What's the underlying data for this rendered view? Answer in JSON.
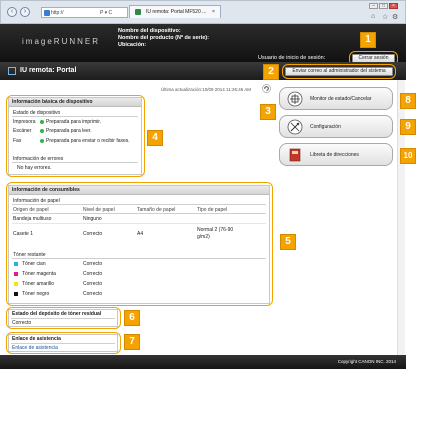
{
  "browser": {
    "url": "http://",
    "url_suffix": "P ▾ C",
    "tab_title": "IU remota: Portal MF520 ...",
    "tab_close": "×",
    "win_controls": [
      "–",
      "□",
      "×"
    ]
  },
  "header": {
    "brand": "imageRUNNER",
    "device_name_label": "Nombre del dispositivo:",
    "product_name_label": "Nombre del producto (Nº de serie):",
    "location_label": "Ubicación:",
    "user_label": "Usuario de inicio de sesión:",
    "logout_label": "Cerrar sesión",
    "email_admin_label": "Enviar correo al administrador del sistema",
    "title": "IU remota: Portal"
  },
  "main": {
    "last_updated": "Última actualización:10/09 2014 11:26:46 AM",
    "basic_info": {
      "heading": "Información básica de dispositivo",
      "status_heading": "Estado de dispositivo",
      "rows": [
        {
          "name": "Impresora",
          "status": "Preparada para imprimir."
        },
        {
          "name": "Escáner",
          "status": "Preparada para leer."
        },
        {
          "name": "Fax",
          "status": "Preparada para enviar o recibir faxes."
        }
      ],
      "errors_heading": "Información de errores",
      "errors_text": "No hay errores."
    },
    "consumables": {
      "heading": "Información de consumibles",
      "paper_heading": "Información de papel",
      "columns": [
        "Origen de papel",
        "Nivel de papel",
        "Tamaño de papel",
        "Tipo de papel"
      ],
      "rows": [
        [
          "Bandeja multiuso",
          "Ninguno",
          "",
          ""
        ],
        [
          "Casete 1",
          "Correcto",
          "A4",
          "Normal 2 (76-90 g/m2)"
        ]
      ],
      "toner_heading": "Tóner restante",
      "toners": [
        {
          "name": "Tóner cian",
          "status": "Correcto",
          "color": "#1fb5e6"
        },
        {
          "name": "Tóner magenta",
          "status": "Correcto",
          "color": "#e6178b"
        },
        {
          "name": "Tóner amarillo",
          "status": "Correcto",
          "color": "#f4e316"
        },
        {
          "name": "Tóner negro",
          "status": "Correcto",
          "color": "#111111"
        }
      ]
    },
    "waste_toner": {
      "heading": "Estado del depósito de tóner residual",
      "value": "Correcto"
    },
    "support": {
      "heading": "Enlace de asistencia",
      "link": "Enlace de asistencia"
    }
  },
  "side": {
    "status_monitor": "Monitor de estado/Cancelar",
    "settings": "Configuración",
    "address_book": "Libreta de direcciones"
  },
  "callouts": [
    "1",
    "2",
    "3",
    "4",
    "5",
    "6",
    "7",
    "8",
    "9",
    "10"
  ],
  "footer": {
    "copyright": "Copyright CANON INC. 2014"
  },
  "colors": {
    "callout": "#f5a300",
    "status_ok": "#33b249"
  }
}
